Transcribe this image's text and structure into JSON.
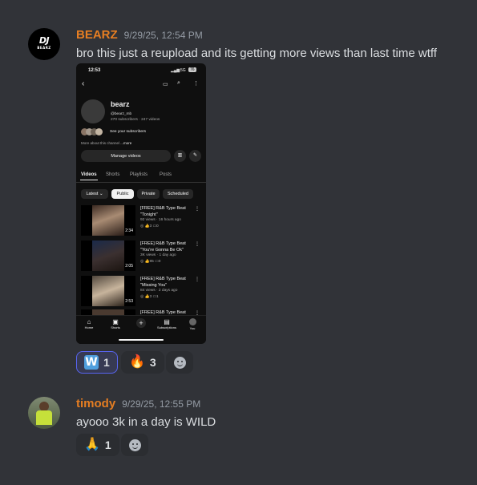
{
  "messages": [
    {
      "username": "BEARZ",
      "username_color": "#e67e22",
      "avatar_logo": "DJ",
      "avatar_logo_sub": "BEARZ",
      "timestamp": "9/29/25, 12:54 PM",
      "text": "bro this just a reupload and its getting more views than last time wtff",
      "reactions": [
        {
          "emoji_name": "w-emoji",
          "emoji_text": "W",
          "count": "1",
          "active": true
        },
        {
          "emoji_name": "fire-emoji",
          "emoji_text": "🔥",
          "count": "3",
          "active": false
        }
      ]
    },
    {
      "username": "timody",
      "username_color": "#e67e22",
      "timestamp": "9/29/25, 12:55 PM",
      "text": "ayooo 3k in a day is WILD",
      "reactions": [
        {
          "emoji_name": "pray-emoji",
          "emoji_text": "🙏",
          "count": "1",
          "active": false
        }
      ]
    }
  ],
  "screenshot": {
    "status_time": "12:53",
    "status_right": "5G",
    "battery": "76",
    "channel_name": "bearz",
    "channel_handle": "@bearz_mb",
    "channel_stats": "270 subscribers · 247 videos",
    "subscribers_link": "See your subscribers",
    "about": "More about this channel",
    "about_more": "...more",
    "manage_videos": "Manage videos",
    "tabs": [
      "Videos",
      "Shorts",
      "Playlists",
      "Posts"
    ],
    "filters": [
      "Latest",
      "Public",
      "Private",
      "Scheduled"
    ],
    "videos": [
      {
        "title": "[FREE] R&B Type Beat \"Tonight\"",
        "meta": "92 views · 16 hours ago",
        "likes": "3",
        "comments": "0",
        "duration": "2:34"
      },
      {
        "title": "[FREE] R&B Type Beat \"You're Gonna Be Ok\"",
        "meta": "3K views · 1 day ago",
        "likes": "85",
        "comments": "0",
        "duration": "2:05"
      },
      {
        "title": "[FREE] R&B Type Beat \"Missing You\"",
        "meta": "84 views · 2 days ago",
        "likes": "3",
        "comments": "1",
        "duration": "2:53"
      },
      {
        "title": "[FREE] R&B Type Beat"
      }
    ],
    "nav": [
      "Home",
      "Shorts",
      "",
      "Subscriptions",
      "You"
    ]
  }
}
